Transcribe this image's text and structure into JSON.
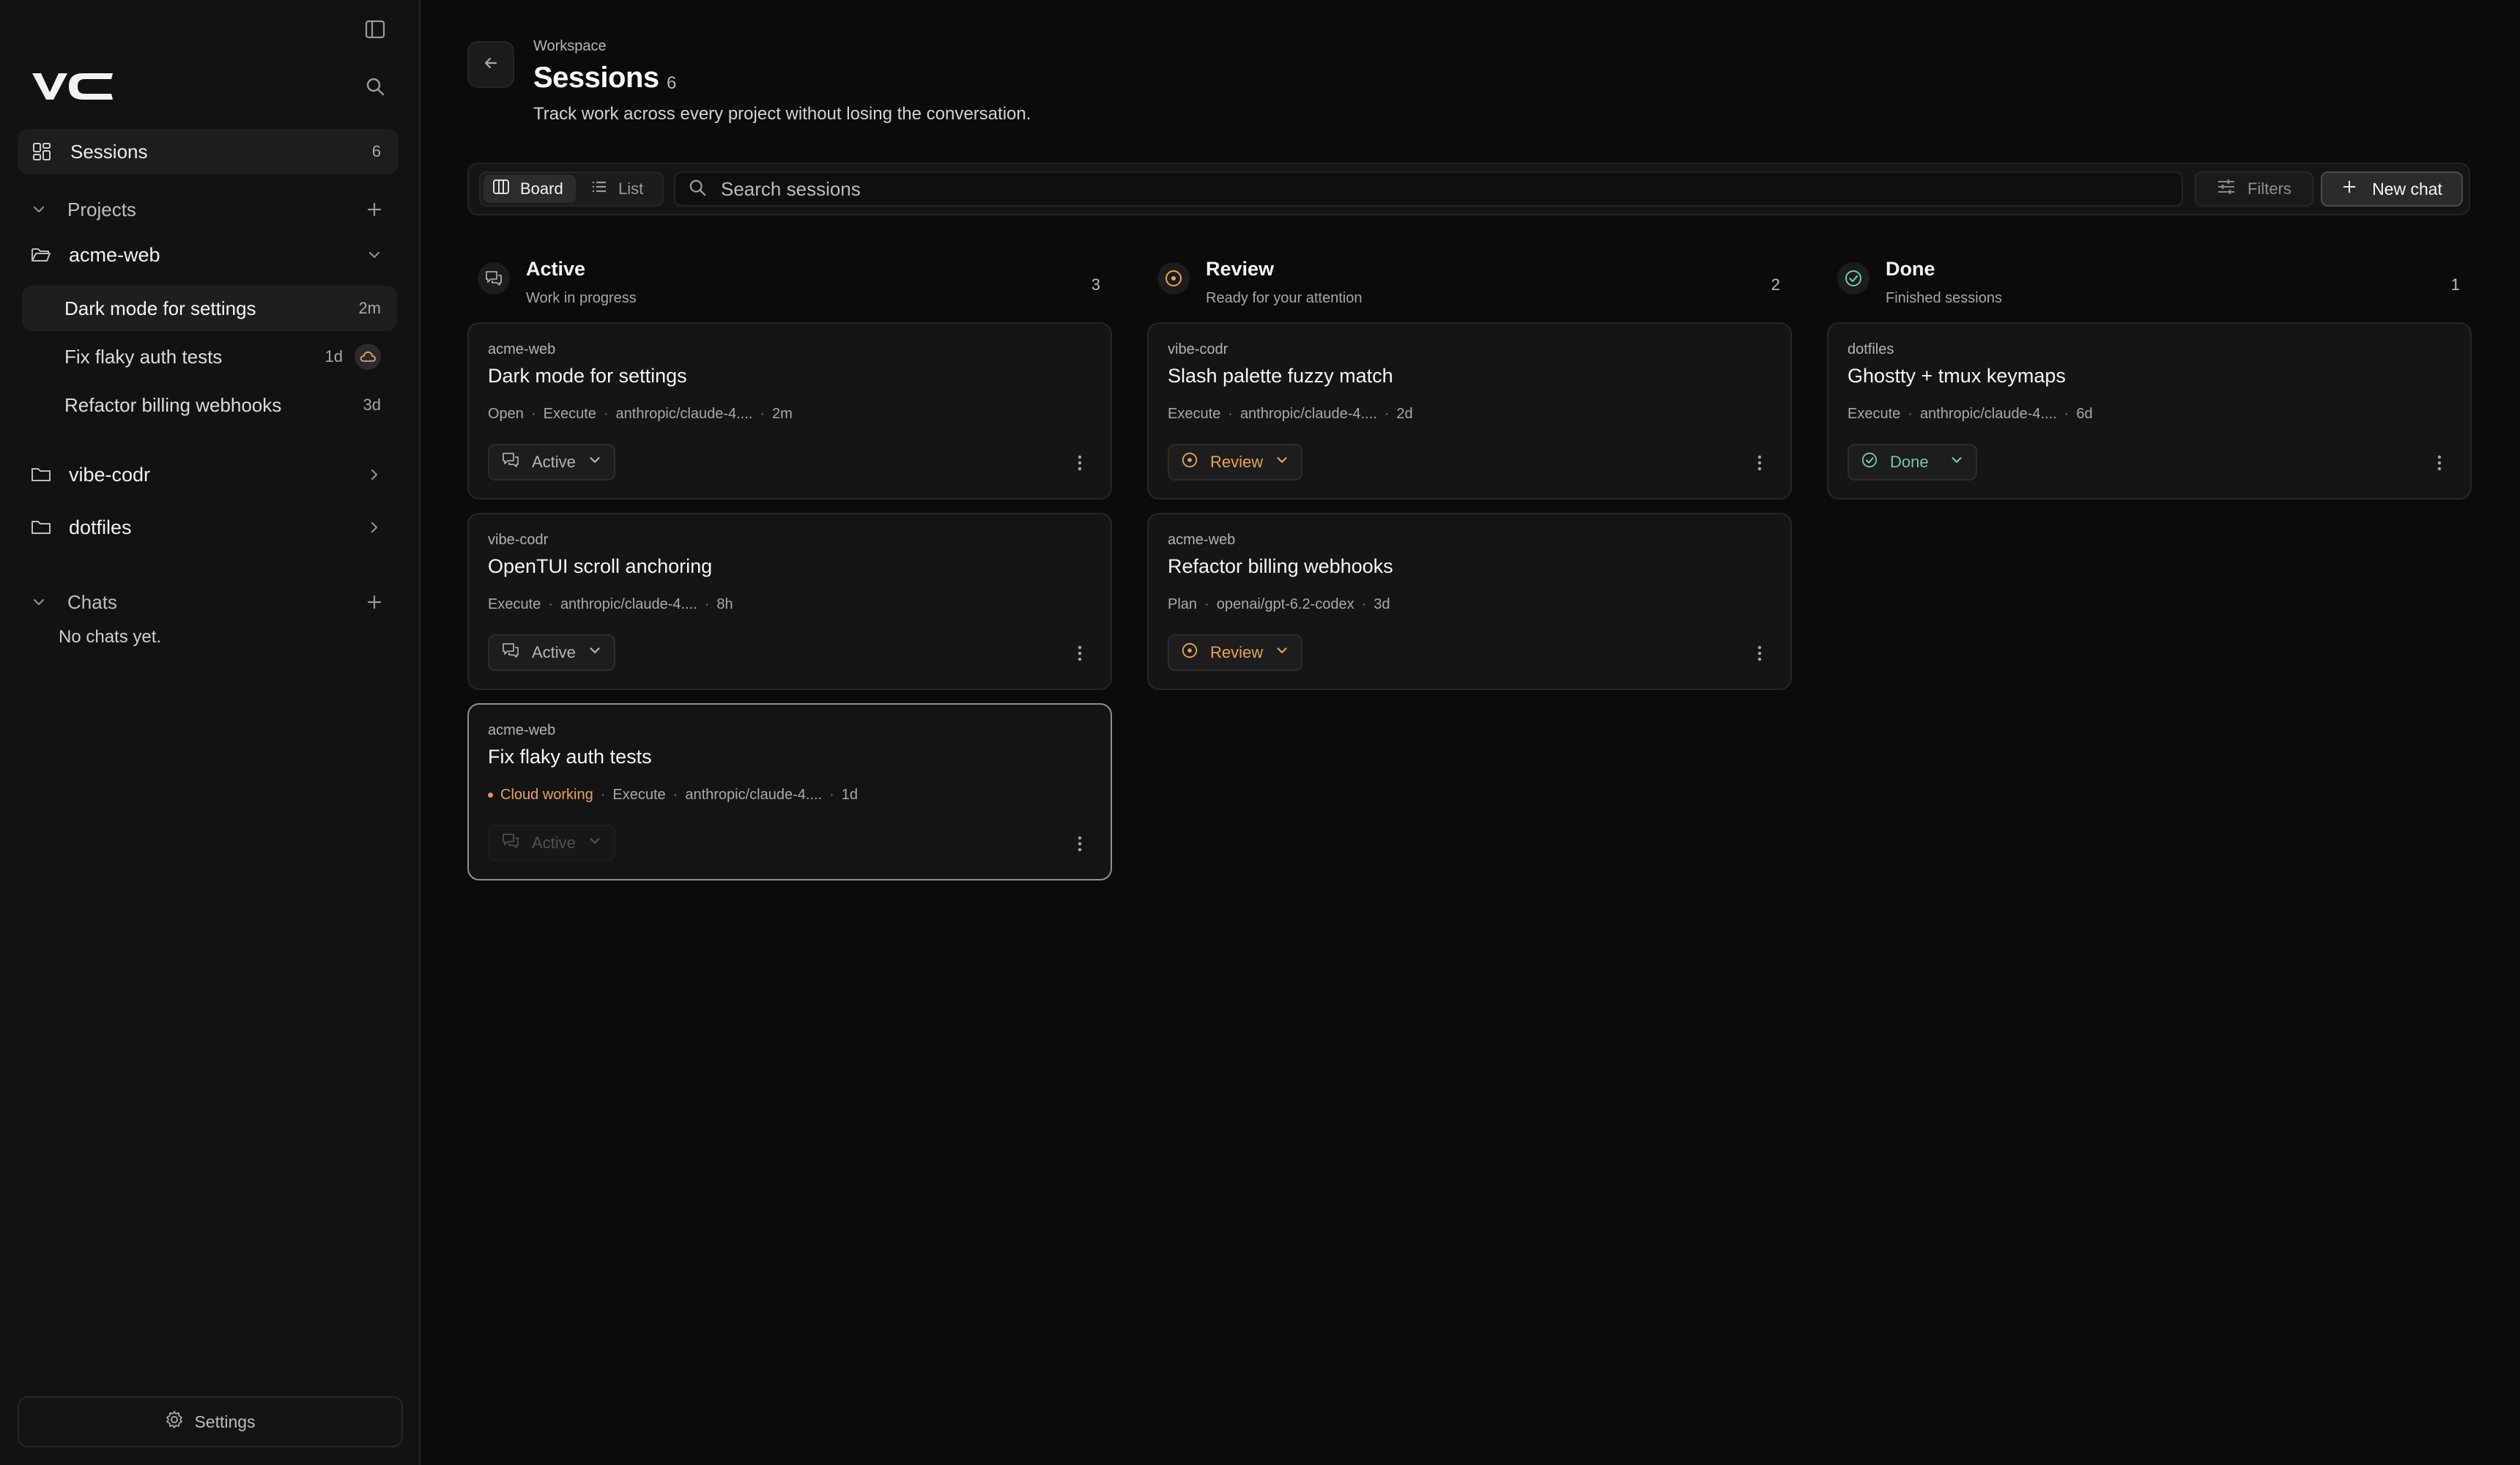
{
  "sidebar": {
    "logo_text": "VC",
    "sessions": {
      "label": "Sessions",
      "count": "6"
    },
    "projects_header": "Projects",
    "projects": [
      {
        "name": "acme-web",
        "expanded": true,
        "items": [
          {
            "label": "Dark mode for settings",
            "age": "2m",
            "selected": true
          },
          {
            "label": "Fix flaky auth tests",
            "age": "1d",
            "cloud": true
          },
          {
            "label": "Refactor billing webhooks",
            "age": "3d"
          }
        ]
      },
      {
        "name": "vibe-codr",
        "expanded": false
      },
      {
        "name": "dotfiles",
        "expanded": false
      }
    ],
    "chats_header": "Chats",
    "chats_empty": "No chats yet.",
    "settings_label": "Settings"
  },
  "header": {
    "breadcrumb": "Workspace",
    "title": "Sessions",
    "count": "6",
    "subtitle": "Track work across every project without losing the conversation."
  },
  "toolbar": {
    "board_label": "Board",
    "list_label": "List",
    "active_view": "Board",
    "search_placeholder": "Search sessions",
    "search_value": "",
    "filters_label": "Filters",
    "new_chat_label": "New chat"
  },
  "columns": [
    {
      "title": "Active",
      "subtitle": "Work in progress",
      "count": "3",
      "cards": [
        {
          "project": "acme-web",
          "title": "Dark mode for settings",
          "meta": [
            "Open",
            "Execute",
            "anthropic/claude-4....",
            "2m"
          ],
          "status": "Active"
        },
        {
          "project": "vibe-codr",
          "title": "OpenTUI scroll anchoring",
          "meta": [
            "Execute",
            "anthropic/claude-4....",
            "8h"
          ],
          "status": "Active"
        },
        {
          "project": "acme-web",
          "title": "Fix flaky auth tests",
          "cloud_status": "Cloud working",
          "meta": [
            "Execute",
            "anthropic/claude-4....",
            "1d"
          ],
          "status": "Active"
        }
      ]
    },
    {
      "title": "Review",
      "subtitle": "Ready for your attention",
      "count": "2",
      "cards": [
        {
          "project": "vibe-codr",
          "title": "Slash palette fuzzy match",
          "meta": [
            "Execute",
            "anthropic/claude-4....",
            "2d"
          ],
          "status": "Review"
        },
        {
          "project": "acme-web",
          "title": "Refactor billing webhooks",
          "meta": [
            "Plan",
            "openai/gpt-6.2-codex",
            "3d"
          ],
          "status": "Review"
        }
      ]
    },
    {
      "title": "Done",
      "subtitle": "Finished sessions",
      "count": "1",
      "cards": [
        {
          "project": "dotfiles",
          "title": "Ghostty + tmux keymaps",
          "meta": [
            "Execute",
            "anthropic/claude-4....",
            "6d"
          ],
          "status": "Done"
        }
      ]
    }
  ],
  "colors": {
    "accent_orange": "#e6a45a",
    "done_green": "#6ecba8",
    "background": "#0b0b0b",
    "sidebar": "#121212"
  }
}
